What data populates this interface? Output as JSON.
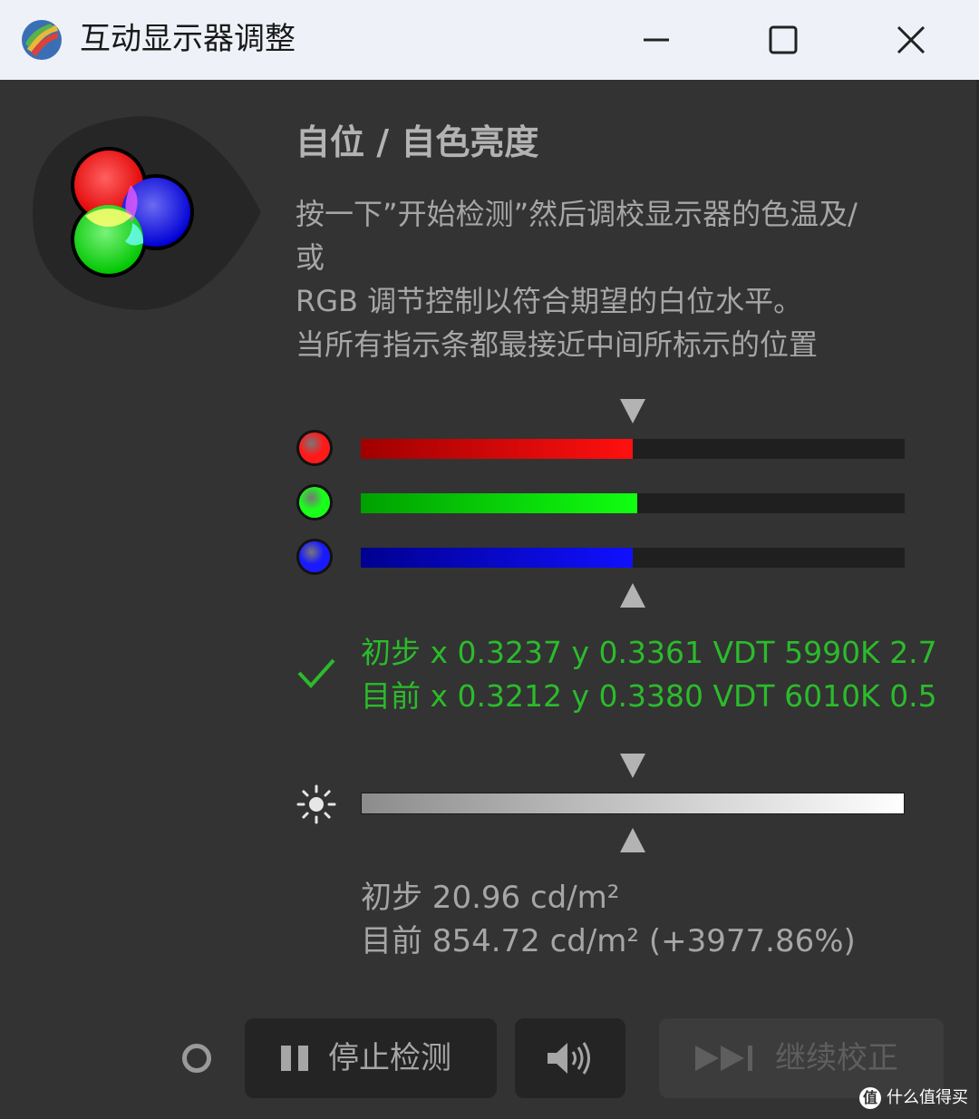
{
  "window": {
    "title": "互动显示器调整",
    "icons": {
      "app": "display-calibration-app-icon",
      "minimize": "minimize-icon",
      "maximize": "maximize-icon",
      "close": "close-icon"
    }
  },
  "section": {
    "title": "自位 / 自色亮度",
    "description_lines": [
      "按一下”开始检测”然后调校显示器的色温及/",
      "或",
      "RGB 调节控制以符合期望的白位水平。",
      "当所有指示条都最接近中间所标示的位置"
    ]
  },
  "rgb_bars": [
    {
      "channel": "red",
      "level": 0.5,
      "color_start": "#a00000",
      "color_end": "#ff1010",
      "dot_color": "#ff1a1a"
    },
    {
      "channel": "green",
      "level": 0.508,
      "color_start": "#00a000",
      "color_end": "#10ff10",
      "dot_color": "#1aff1a"
    },
    {
      "channel": "blue",
      "level": 0.5,
      "color_start": "#000090",
      "color_end": "#1010ff",
      "dot_color": "#1a1aff"
    }
  ],
  "target_marker_level": 0.5,
  "readout": {
    "status_icon": "checkmark-icon",
    "initial": "初步 x 0.3237 y 0.3361 VDT 5990K 2.7",
    "current": "目前 x 0.3212 y 0.3380 VDT 6010K 0.5",
    "color": "#2bbb2b"
  },
  "luminance": {
    "icon": "brightness-sun-icon",
    "level": 1.0,
    "initial": "初步 20.96 cd/m²",
    "current": "目前 854.72 cd/m² (+3977.86%)"
  },
  "controls": {
    "status_indicator": "status-ring-icon",
    "stop_button": {
      "label": "停止检测",
      "icon": "pause-icon"
    },
    "sound_button": {
      "icon": "speaker-icon"
    },
    "continue_button": {
      "label": "继续校正",
      "icon": "skip-forward-icon",
      "enabled": false
    }
  },
  "watermark": {
    "text": "什么值得买",
    "logo_text": "值"
  }
}
